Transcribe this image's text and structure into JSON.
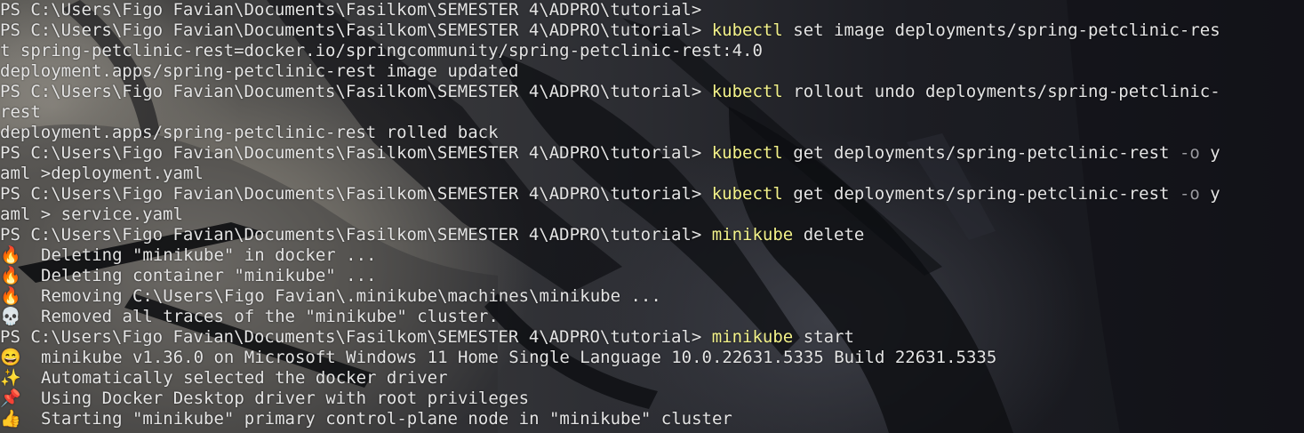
{
  "prompt": "PS C:\\Users\\Figo Favian\\Documents\\Fasilkom\\SEMESTER 4\\ADPRO\\tutorial> ",
  "lines": [
    {
      "kind": "prompt",
      "cmd": "",
      "args": ""
    },
    {
      "kind": "prompt",
      "cmd": "kubectl",
      "args": " set image deployments/spring-petclinic-res"
    },
    {
      "kind": "text",
      "text": "t spring-petclinic-rest=docker.io/springcommunity/spring-petclinic-rest:4.0"
    },
    {
      "kind": "text",
      "text": "deployment.apps/spring-petclinic-rest image updated"
    },
    {
      "kind": "prompt",
      "cmd": "kubectl",
      "args": " rollout undo deployments/spring-petclinic-"
    },
    {
      "kind": "text",
      "text": "rest"
    },
    {
      "kind": "text",
      "text": "deployment.apps/spring-petclinic-rest rolled back"
    },
    {
      "kind": "prompt",
      "cmd": "kubectl",
      "args": " get deployments/spring-petclinic-rest ",
      "flag": "-o",
      "tail": " y"
    },
    {
      "kind": "text",
      "text": "aml >deployment.yaml"
    },
    {
      "kind": "prompt",
      "cmd": "kubectl",
      "args": " get deployments/spring-petclinic-rest ",
      "flag": "-o",
      "tail": " y"
    },
    {
      "kind": "text",
      "text": "aml > service.yaml"
    },
    {
      "kind": "prompt",
      "cmd": "minikube",
      "args": " delete"
    },
    {
      "kind": "emoji",
      "icon": "🔥",
      "text": "Deleting \"minikube\" in docker ..."
    },
    {
      "kind": "emoji",
      "icon": "🔥",
      "text": "Deleting container \"minikube\" ..."
    },
    {
      "kind": "emoji",
      "icon": "🔥",
      "text": "Removing C:\\Users\\Figo Favian\\.minikube\\machines\\minikube ..."
    },
    {
      "kind": "emoji",
      "icon": "💀",
      "text": "Removed all traces of the \"minikube\" cluster."
    },
    {
      "kind": "prompt",
      "cmd": "minikube",
      "args": " start"
    },
    {
      "kind": "emoji",
      "icon": "😄",
      "text": "minikube v1.36.0 on Microsoft Windows 11 Home Single Language 10.0.22631.5335 Build 22631.5335"
    },
    {
      "kind": "emoji",
      "icon": "✨",
      "text": "Automatically selected the docker driver"
    },
    {
      "kind": "emoji",
      "icon": "📌",
      "text": "Using Docker Desktop driver with root privileges"
    },
    {
      "kind": "emoji",
      "icon": "👍",
      "text": "Starting \"minikube\" primary control-plane node in \"minikube\" cluster"
    }
  ],
  "icons": {
    "fire": "fire-icon",
    "skull": "skull-icon",
    "smile": "smile-icon",
    "sparkles": "sparkles-icon",
    "pin": "pushpin-icon",
    "thumbs": "thumbs-up-icon"
  },
  "colors": {
    "text": "#e4e4e4",
    "command": "#f3f28a",
    "flag": "#9a9aa0"
  }
}
